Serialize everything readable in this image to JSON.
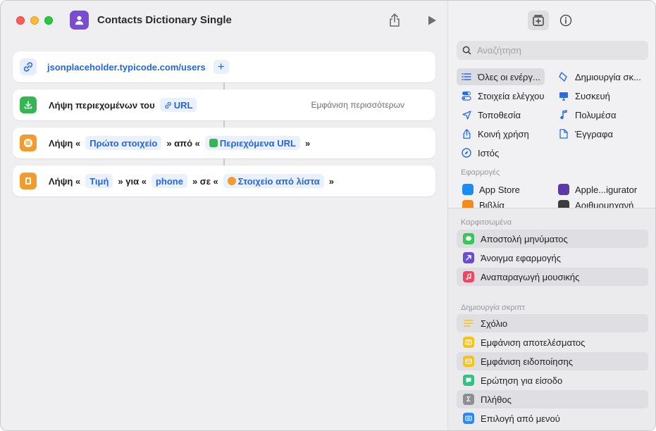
{
  "window": {
    "title": "Contacts Dictionary Single"
  },
  "colors": {
    "accent": "#2266e6",
    "app_icon": "#7a4ccf"
  },
  "actions": [
    {
      "type": "url",
      "value": "jsonplaceholder.typicode.com/users",
      "icon": "link-icon"
    },
    {
      "type": "get_contents",
      "label": "Λήψη περιεχομένων του",
      "token": "URL",
      "more": "Εμφάνιση περισσότερων",
      "icon": "download-icon"
    },
    {
      "type": "get_item",
      "prefix": "Λήψη «",
      "token1": "Πρώτο στοιχείο",
      "middle": "» από «",
      "token2": "Περιεχόμενα URL",
      "suffix": "»",
      "icon": "list-icon"
    },
    {
      "type": "get_value",
      "prefix": "Λήψη «",
      "token1": "Τιμή",
      "middle1": "» για «",
      "token2": "phone",
      "middle2": "» σε «",
      "token3": "Στοιχείο από λίστα",
      "suffix": "»",
      "icon": "dictionary-icon"
    }
  ],
  "sidebar": {
    "search_placeholder": "Αναζήτηση",
    "categories_left": [
      "Όλες οι ενέργ...",
      "Στοιχεία ελέγχου",
      "Τοποθεσία",
      "Κοινή χρήση",
      "Ιστός"
    ],
    "categories_right": [
      "Δημιουργία σκ...",
      "Συσκευή",
      "Πολυμέσα",
      "Έγγραφα"
    ],
    "apps_heading": "Εφαρμογές",
    "apps": [
      "App Store",
      "Apple...igurator",
      "Βιβλία",
      "Αριθμομηχανή"
    ],
    "pinned_heading": "Καρφιτσωμένα",
    "pinned": [
      "Αποστολή μηνύματος",
      "Άνοιγμα εφαρμογής",
      "Αναπαραγωγή μουσικής"
    ],
    "scripting_heading": "Δημιουργία σκριπτ",
    "scripting": [
      "Σχόλιο",
      "Εμφάνιση αποτελέσματος",
      "Εμφάνιση ειδοποίησης",
      "Ερώτηση για είσοδο",
      "Πλήθος",
      "Επιλογή από μενού"
    ]
  }
}
